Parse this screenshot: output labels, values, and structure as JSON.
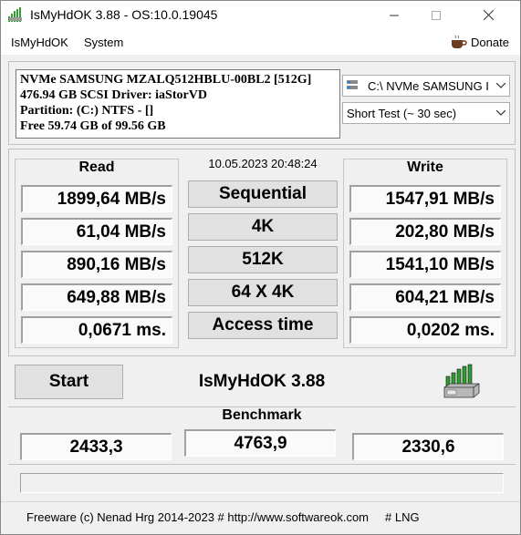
{
  "window": {
    "title": "IsMyHdOK 3.88 - OS:10.0.19045"
  },
  "menu": {
    "items": [
      "IsMyHdOK",
      "System"
    ],
    "donate_label": "Donate"
  },
  "drive_info": {
    "line1": "NVMe SAMSUNG MZALQ512HBLU-00BL2 [512G]",
    "line2": "476.94 GB  SCSI Driver: iaStorVD",
    "line3": "Partition: (C:) NTFS - []",
    "line4": "Free 59.74 GB of 99.56 GB"
  },
  "drive_select": {
    "value": "C:\\ NVMe SAMSUNG I"
  },
  "test_select": {
    "value": "Short Test (~ 30 sec)"
  },
  "timestamp": "10.05.2023 20:48:24",
  "read": {
    "title": "Read",
    "values": [
      "1899,64 MB/s",
      "61,04 MB/s",
      "890,16 MB/s",
      "649,88 MB/s",
      "0,0671 ms."
    ]
  },
  "write": {
    "title": "Write",
    "values": [
      "1547,91 MB/s",
      "202,80 MB/s",
      "1541,10 MB/s",
      "604,21 MB/s",
      "0,0202 ms."
    ]
  },
  "tests": [
    "Sequential",
    "4K",
    "512K",
    "64 X 4K",
    "Access time"
  ],
  "start_label": "Start",
  "app_name": "IsMyHdOK 3.88",
  "benchmark": {
    "title": "Benchmark",
    "read": "2433,3",
    "total": "4763,9",
    "write": "2330,6"
  },
  "progress": {
    "value": 0
  },
  "status": {
    "text": "Freeware (c) Nenad Hrg 2014-2023 # http://www.softwareok.com",
    "lng": "# LNG"
  },
  "colors": {
    "accent_green": "#06b025",
    "icon_green": "#2e9e2e"
  }
}
